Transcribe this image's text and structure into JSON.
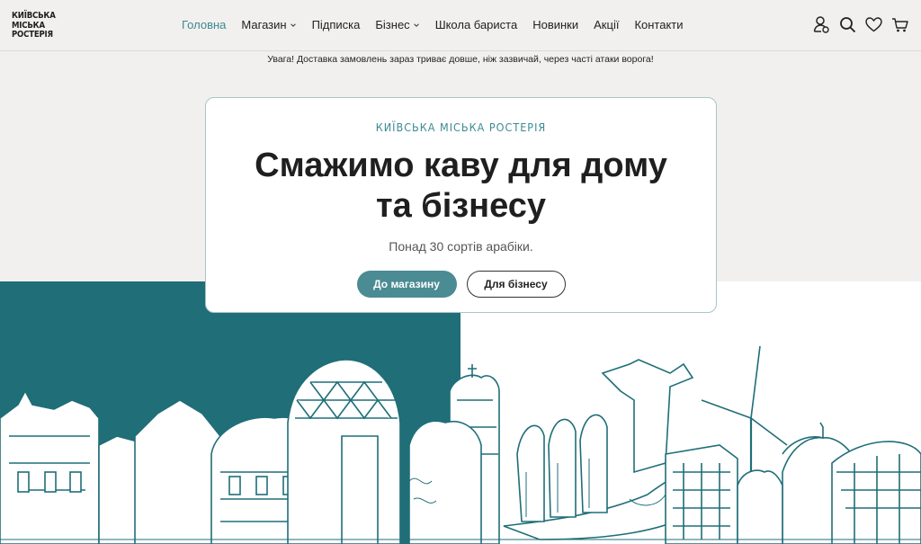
{
  "header": {
    "logo_lines": [
      "КИЇВСЬКА",
      "МІСЬКА",
      "РОСТЕРІЯ"
    ],
    "nav": [
      {
        "label": "Головна",
        "active": true,
        "dropdown": false
      },
      {
        "label": "Магазин",
        "active": false,
        "dropdown": true
      },
      {
        "label": "Підписка",
        "active": false,
        "dropdown": false
      },
      {
        "label": "Бізнес",
        "active": false,
        "dropdown": true
      },
      {
        "label": "Школа бариста",
        "active": false,
        "dropdown": false
      },
      {
        "label": "Новинки",
        "active": false,
        "dropdown": false
      },
      {
        "label": "Акції",
        "active": false,
        "dropdown": false
      },
      {
        "label": "Контакти",
        "active": false,
        "dropdown": false
      }
    ],
    "icons": [
      "user-icon",
      "search-icon",
      "heart-icon",
      "cart-icon"
    ]
  },
  "notice": "Увага! Доставка замовлень зараз триває довше, ніж зазвичай, через часті атаки ворога!",
  "hero": {
    "brand": "КИЇВСЬКА МІСЬКА РОСТЕРІЯ",
    "title_line1": "Смажимо каву для дому",
    "title_line2": "та бізнесу",
    "subtitle": "Понад 30 сортів арабіки.",
    "primary_button": "До магазину",
    "secondary_button": "Для бізнесу"
  },
  "colors": {
    "accent": "#3b8a93",
    "teal": "#1f6e78",
    "button": "#4b8b93",
    "background": "#f2f0ee"
  }
}
